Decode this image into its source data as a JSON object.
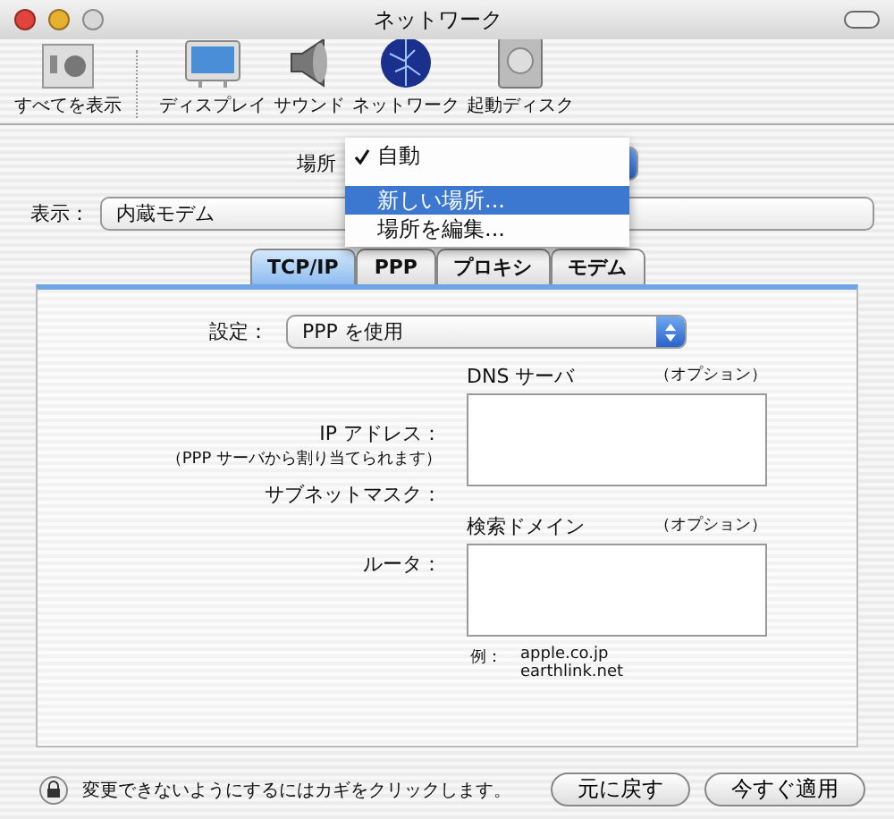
{
  "window": {
    "title": "ネットワーク"
  },
  "toolbar": [
    {
      "label": "すべてを表示",
      "kind": "prefs"
    },
    {
      "label": "ディスプレイ",
      "kind": "display"
    },
    {
      "label": "サウンド",
      "kind": "sound"
    },
    {
      "label": "ネットワーク",
      "kind": "network"
    },
    {
      "label": "起動ディスク",
      "kind": "disk"
    }
  ],
  "location": {
    "label": "場所",
    "menu": [
      {
        "label": "自動",
        "checked": true,
        "selected": false
      },
      {
        "label": "新しい場所...",
        "checked": false,
        "selected": true
      },
      {
        "label": "場所を編集...",
        "checked": false,
        "selected": false
      }
    ]
  },
  "show": {
    "label": "表示：",
    "value": "内蔵モデム"
  },
  "tabs": [
    {
      "label": "TCP/IP",
      "selected": true
    },
    {
      "label": "PPP",
      "selected": false
    },
    {
      "label": "プロキシ",
      "selected": false
    },
    {
      "label": "モデム",
      "selected": false
    }
  ],
  "config": {
    "label": "設定：",
    "value": "PPP を使用"
  },
  "ip_address": {
    "label": "IP アドレス：",
    "note": "（PPP サーバから割り当てられます）"
  },
  "subnet_mask": {
    "label": "サブネットマスク："
  },
  "router": {
    "label": "ルータ："
  },
  "dns": {
    "label": "DNS サーバ",
    "optional": "（オプション）"
  },
  "search_domains": {
    "label": "検索ドメイン",
    "optional": "（オプション）"
  },
  "example": {
    "label": "例：",
    "values": [
      "apple.co.jp",
      "earthlink.net"
    ]
  },
  "lock_text": "変更できないようにするにはカギをクリックします。",
  "buttons": [
    "元に戻す",
    "今すぐ適用"
  ]
}
